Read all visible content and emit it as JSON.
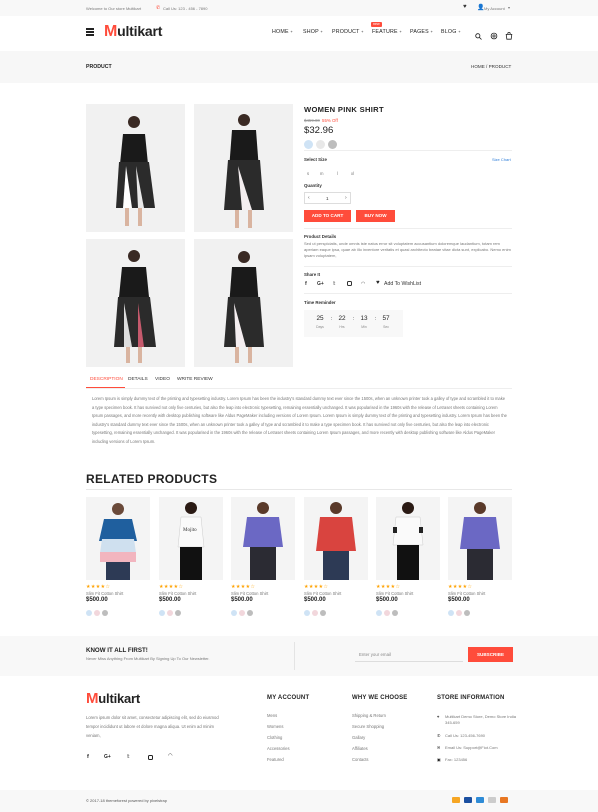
{
  "topbar": {
    "welcome": "Welcome to Our store Multikart",
    "call": "Call Us: 123 - 456 - 7890",
    "account": "My Account"
  },
  "header": {
    "logo_m": "M",
    "logo_rest": "ultikart",
    "nav": [
      "HOME",
      "SHOP",
      "PRODUCT",
      "FEATURE",
      "PAGES",
      "BLOG"
    ],
    "new_badge": "new"
  },
  "breadcrumb": {
    "title": "PRODUCT",
    "trail": "HOME / PRODUCT"
  },
  "product": {
    "name": "WOMEN PINK SHIRT",
    "old_price": "$459.00",
    "discount": "55% Off",
    "price": "$32.96",
    "select_size_label": "Select Size",
    "size_chart": "Size Chart",
    "sizes": [
      "s",
      "m",
      "l",
      "xl"
    ],
    "quantity_label": "Quantity",
    "quantity": "1",
    "add_to_cart": "ADD TO CART",
    "buy_now": "BUY NOW",
    "details_label": "Product Details",
    "details_text": "Sed ut perspiciatis, unde omnis iste natus error sit voluptatem accusantium doloremque laudantium, totam rem aperiam eaque ipsa, quae ab illo inventore veritatis et quasi architecto beatae vitae dicta sunt, explicabo. Nemo enim ipsam voluptatem,",
    "share_label": "Share It",
    "wishlist": "Add To WishList",
    "timer_label": "Time Reminder",
    "timer": [
      {
        "value": "25",
        "unit": "Days"
      },
      {
        "value": "22",
        "unit": "Hrs"
      },
      {
        "value": "13",
        "unit": "Min"
      },
      {
        "value": "57",
        "unit": "Sec"
      }
    ]
  },
  "tabs": [
    "DESCRIPTION",
    "DETAILS",
    "VIDEO",
    "WRITE REVIEW"
  ],
  "description": "Lorem Ipsum is simply dummy text of the printing and typesetting industry. Lorem Ipsum has been the industry's standard dummy text ever since the 1500s, when an unknown printer took a galley of type and scrambled it to make a type specimen book. It has survived not only five centuries, but also the leap into electronic typesetting, remaining essentially unchanged. It was popularised in the 1960s with the release of Letraset sheets containing Lorem Ipsum passages, and more recently with desktop publishing software like Aldus PageMaker including versions of Lorem Ipsum. Lorem Ipsum is simply dummy text of the printing and typesetting industry. Lorem Ipsum has been the industry's standard dummy text ever since the 1500s, when an unknown printer took a galley of type and scrambled it to make a type specimen book. It has survived not only five centuries, but also the leap into electronic typesetting, remaining essentially unchanged. It was popularised in the 1960s with the release of Letraset sheets containing Lorem Ipsum passages, and more recently with desktop publishing software like Aldus PageMaker including versions of Lorem Ipsum.",
  "related": {
    "heading": "RELATED PRODUCTS",
    "items": [
      {
        "title": "Slim Fit Cotton Shirt",
        "price": "$500.00",
        "stars": "★★★★☆"
      },
      {
        "title": "Slim Fit Cotton Shirt",
        "price": "$500.00",
        "stars": "★★★★☆"
      },
      {
        "title": "Slim Fit Cotton Shirt",
        "price": "$500.00",
        "stars": "★★★★☆"
      },
      {
        "title": "Slim Fit Cotton Shirt",
        "price": "$500.00",
        "stars": "★★★★☆"
      },
      {
        "title": "Slim Fit Cotton Shirt",
        "price": "$500.00",
        "stars": "★★★★☆"
      },
      {
        "title": "Slim Fit Cotton Shirt",
        "price": "$500.00",
        "stars": "★★★★☆"
      }
    ]
  },
  "newsletter": {
    "title": "KNOW IT ALL FIRST!",
    "subtitle": "Never Miss Anything From Multikart By Signing Up To Our Newsletter.",
    "placeholder": "Enter your email",
    "button": "SUBSCRIBE"
  },
  "footer": {
    "about": "Lorem ipsum dolor sit amet, consectetur adipiscing elit, sed do eiusmod tempor incididunt ut labore et dolore magna aliqua. Ut enim ad minim veniam,",
    "my_account_title": "MY ACCOUNT",
    "my_account": [
      "Mens",
      "Womens",
      "Clothing",
      "Accessories",
      "Featured"
    ],
    "why_title": "WHY WE CHOOSE",
    "why": [
      "Shipping & Return",
      "Secure Shopping",
      "Gallary",
      "Affiliates",
      "Contacts"
    ],
    "store_title": "STORE INFORMATION",
    "store": [
      "Multikart Demo Store, Demo Store India 345-659",
      "Call Us: 123-456-7690",
      "Email Us: Support@Fiot.Com",
      "Fax: 123456"
    ],
    "copyright": "© 2017-18 themeforest powered by pixelstrap"
  },
  "colors": {
    "accent": "#ff4c3b",
    "swatches": [
      "#cfe3f5",
      "#e8e8e8",
      "#bdbdbd"
    ]
  }
}
